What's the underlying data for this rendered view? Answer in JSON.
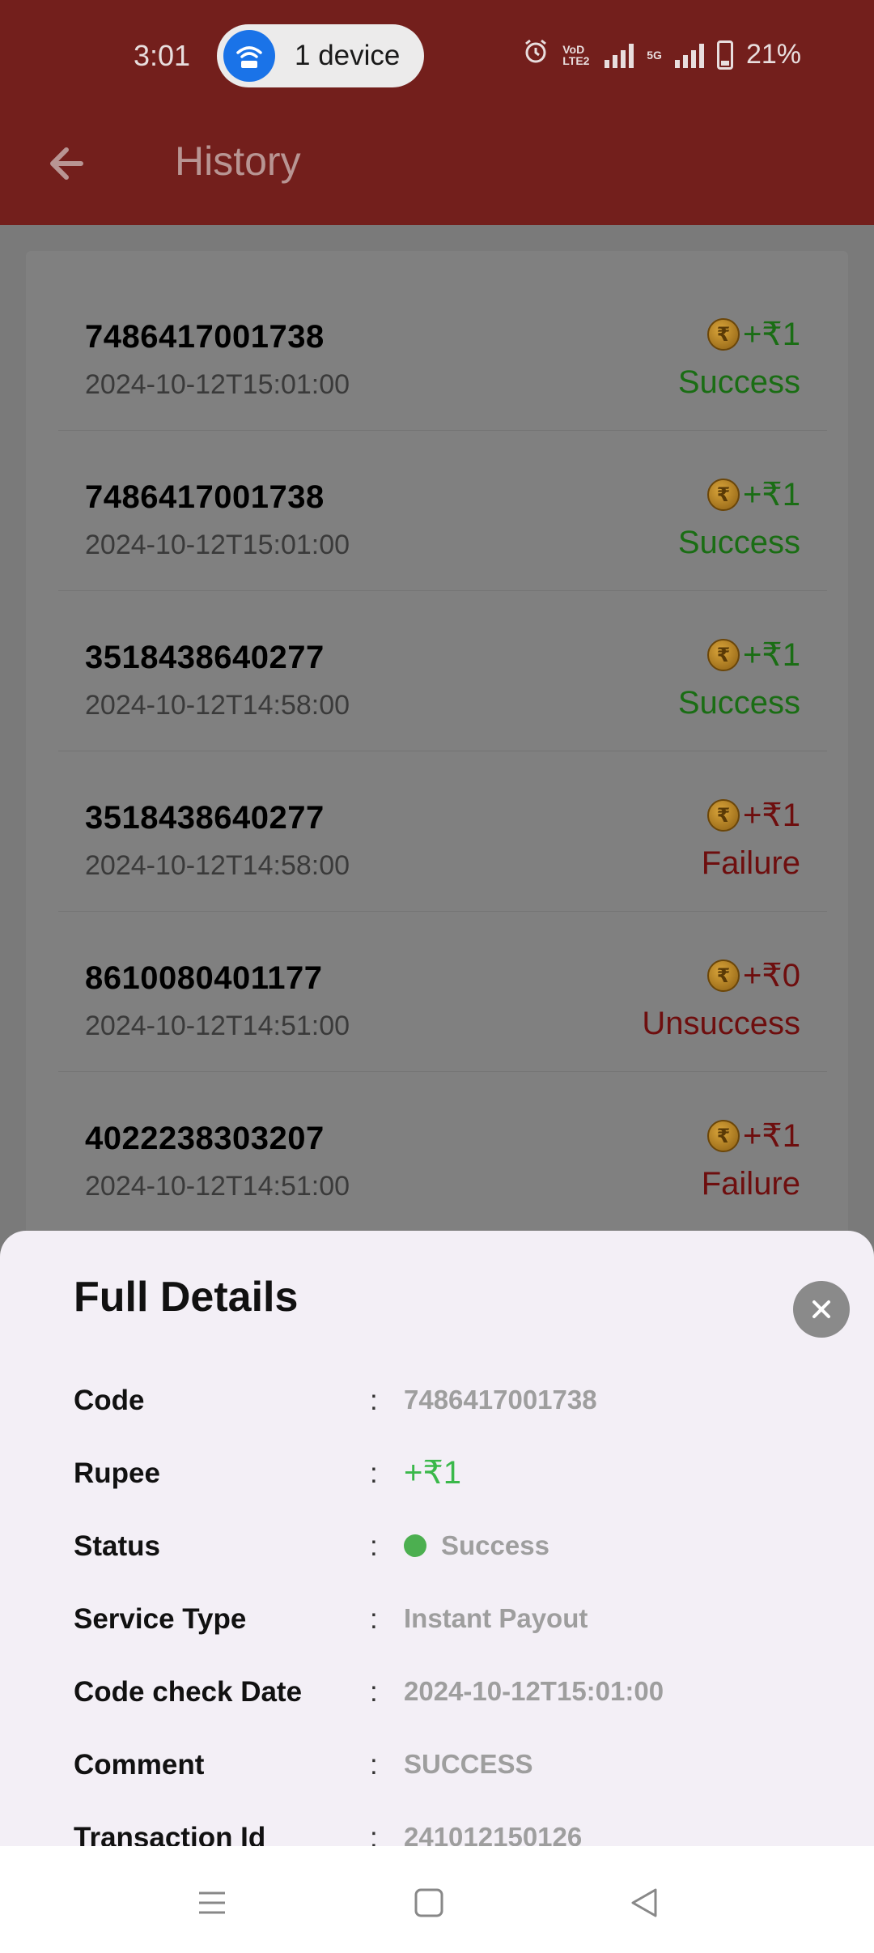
{
  "status_bar": {
    "time": "3:01",
    "hotspot_label": "1 device",
    "volte_label": "VoD LTE2",
    "net_label": "5G",
    "battery": "21%"
  },
  "app_bar": {
    "title": "History"
  },
  "history": [
    {
      "code": "7486417001738",
      "date": "2024-10-12T15:01:00",
      "amount": "+₹1",
      "status": "Success",
      "status_color": "#1a6d14"
    },
    {
      "code": "7486417001738",
      "date": "2024-10-12T15:01:00",
      "amount": "+₹1",
      "status": "Success",
      "status_color": "#1a6d14"
    },
    {
      "code": "3518438640277",
      "date": "2024-10-12T14:58:00",
      "amount": "+₹1",
      "status": "Success",
      "status_color": "#1a6d14"
    },
    {
      "code": "3518438640277",
      "date": "2024-10-12T14:58:00",
      "amount": "+₹1",
      "status": "Failure",
      "status_color": "#6e0e0e"
    },
    {
      "code": "8610080401177",
      "date": "2024-10-12T14:51:00",
      "amount": "+₹0",
      "status": "Unsuccess",
      "status_color": "#6e0e0e"
    },
    {
      "code": "4022238303207",
      "date": "2024-10-12T14:51:00",
      "amount": "+₹1",
      "status": "Failure",
      "status_color": "#6e0e0e"
    }
  ],
  "sheet": {
    "title": "Full Details",
    "separator": ":",
    "details": [
      {
        "label": "Code",
        "value": "7486417001738"
      },
      {
        "label": "Rupee",
        "value": "+₹1"
      },
      {
        "label": "Status",
        "value": "Success"
      },
      {
        "label": "Service Type",
        "value": "Instant Payout"
      },
      {
        "label": "Code check Date",
        "value": "2024-10-12T15:01:00"
      },
      {
        "label": "Comment",
        "value": "SUCCESS"
      },
      {
        "label": "Transaction Id",
        "value": "241012150126"
      }
    ]
  },
  "colors": {
    "app_bar_dimmed": "#731f1c",
    "success_green": "#3ab84a",
    "status_dot": "#4caf50"
  }
}
